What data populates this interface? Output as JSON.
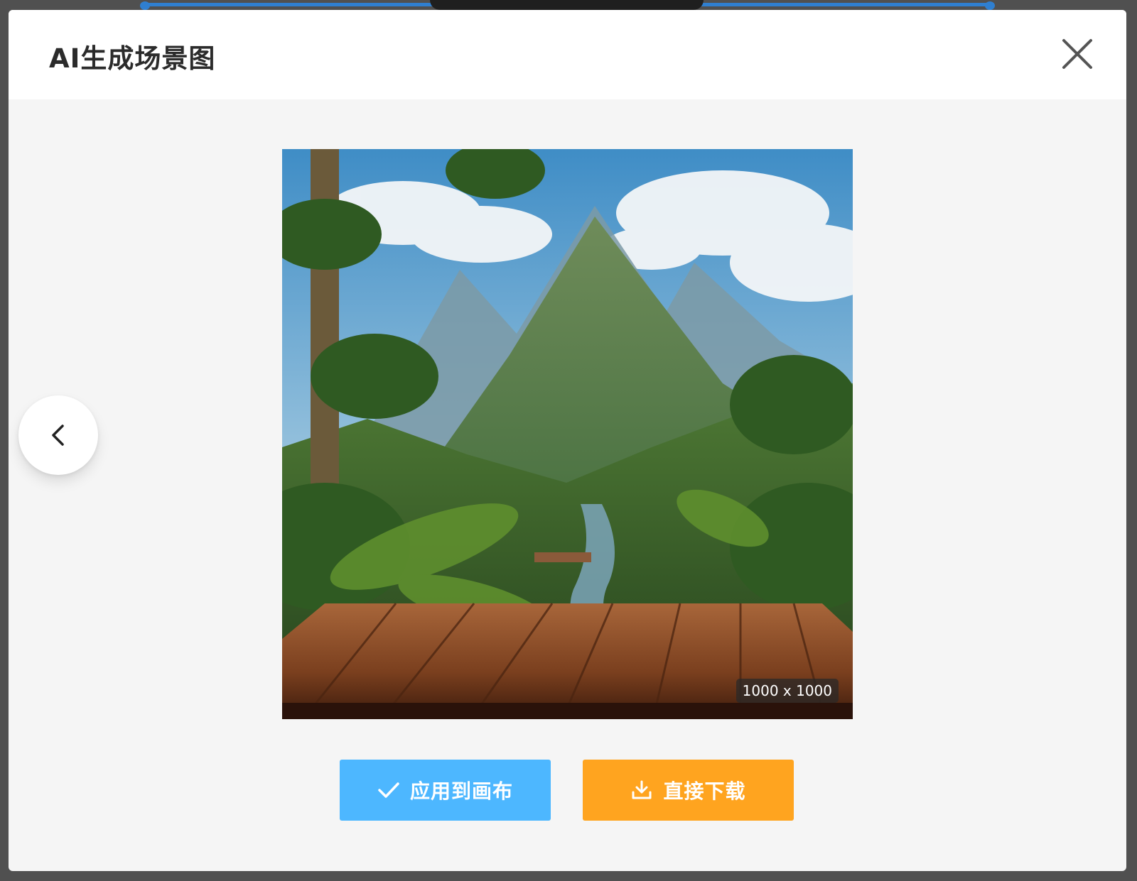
{
  "modal": {
    "title": "AI生成场景图",
    "image_size_label": "1000 x 1000",
    "image_alt": "热带雨林山景与木质桌面"
  },
  "actions": {
    "apply_label": "应用到画布",
    "download_label": "直接下载"
  },
  "icons": {
    "close": "close-icon",
    "prev": "chevron-left-icon",
    "apply": "check-icon",
    "download": "download-icon"
  },
  "colors": {
    "apply_button": "#4db7ff",
    "download_button": "#ffa41f",
    "header_bg": "#ffffff",
    "body_bg": "#f5f5f5"
  }
}
